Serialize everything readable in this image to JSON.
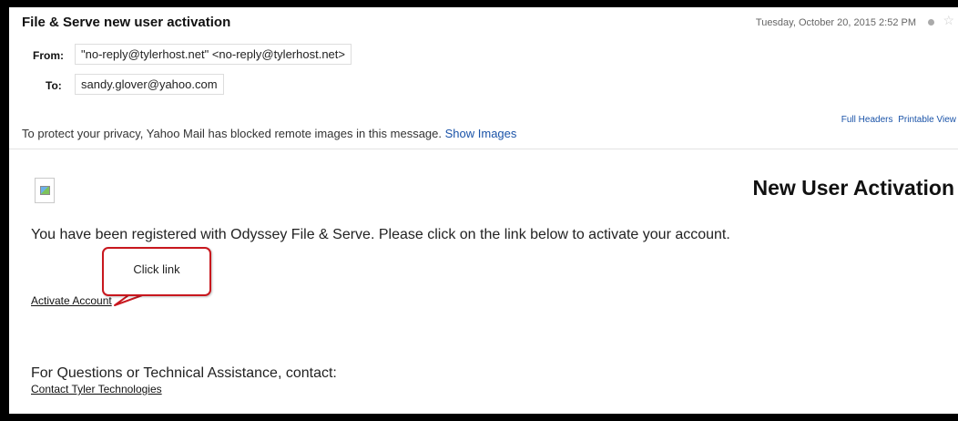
{
  "email": {
    "subject": "File & Serve new user activation",
    "datetime": "Tuesday, October 20, 2015 2:52 PM",
    "from_label": "From:",
    "from_value": "\"no-reply@tylerhost.net\" <no-reply@tylerhost.net>",
    "to_label": "To:",
    "to_value": "sandy.glover@yahoo.com",
    "header_links": [
      "Full Headers",
      "Printable View"
    ],
    "privacy_notice": "To protect your privacy, Yahoo Mail has blocked remote images in this message.",
    "show_images_label": "Show Images"
  },
  "message": {
    "heading": "New User Activation",
    "body": "You have been registered with Odyssey File & Serve. Please click on the link below to activate your account.",
    "activate_link": "Activate Account",
    "questions": "For Questions or Technical Assistance, contact:",
    "contact_link": "Contact Tyler Technologies"
  },
  "annotation": {
    "callout_text": "Click link",
    "color": "#c8171e"
  },
  "colors": {
    "link_blue": "#1a53a8",
    "frame": "#000000"
  },
  "icons": {
    "broken_image": "broken-image-icon",
    "star": "star-icon",
    "status_dot": "status-dot-icon"
  }
}
